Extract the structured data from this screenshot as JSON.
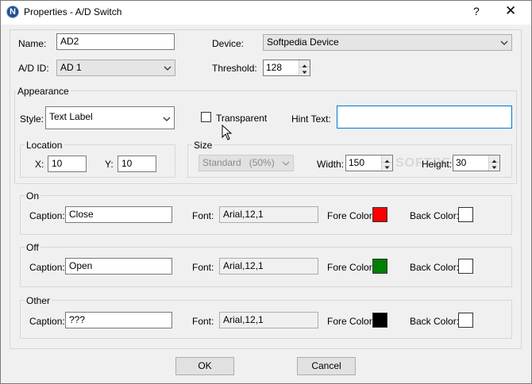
{
  "window": {
    "title": "Properties - A/D Switch",
    "app_icon_letter": "N",
    "help_glyph": "?",
    "close_glyph": "✕"
  },
  "general": {
    "name_label": "Name:",
    "name_value": "AD2",
    "device_label": "Device:",
    "device_value": "Softpedia Device",
    "adid_label": "A/D ID:",
    "adid_value": "AD 1",
    "threshold_label": "Threshold:",
    "threshold_value": "128"
  },
  "appearance": {
    "group_label": "Appearance",
    "style_label": "Style:",
    "style_value": "Text Label",
    "transparent_label": "Transparent",
    "transparent_checked": false,
    "hint_label": "Hint Text:",
    "hint_value": ""
  },
  "location": {
    "group_label": "Location",
    "x_label": "X:",
    "x_value": "10",
    "y_label": "Y:",
    "y_value": "10"
  },
  "size": {
    "group_label": "Size",
    "preset_value": "Standard   (50%)",
    "width_label": "Width:",
    "width_value": "150",
    "height_label": "Height:",
    "height_value": "30"
  },
  "states": [
    {
      "group_label": "On",
      "caption_label": "Caption:",
      "caption_value": "Close",
      "font_label": "Font:",
      "font_value": "Arial,12,1",
      "fore_label": "Fore Color:",
      "fore_color": "#ff0000",
      "back_label": "Back Color:",
      "back_color": "#ffffff"
    },
    {
      "group_label": "Off",
      "caption_label": "Caption:",
      "caption_value": "Open",
      "font_label": "Font:",
      "font_value": "Arial,12,1",
      "fore_label": "Fore Color:",
      "fore_color": "#008000",
      "back_label": "Back Color:",
      "back_color": "#ffffff"
    },
    {
      "group_label": "Other",
      "caption_label": "Caption:",
      "caption_value": "???",
      "font_label": "Font:",
      "font_value": "Arial,12,1",
      "fore_label": "Fore Color:",
      "fore_color": "#000000",
      "back_label": "Back Color:",
      "back_color": "#ffffff"
    }
  ],
  "buttons": {
    "ok_label": "OK",
    "cancel_label": "Cancel"
  },
  "watermark": "SOFTPEDIA",
  "icons": {
    "dropdown": "chevron-down-icon",
    "spin_up": "triangle-up-icon",
    "spin_down": "triangle-down-icon"
  }
}
